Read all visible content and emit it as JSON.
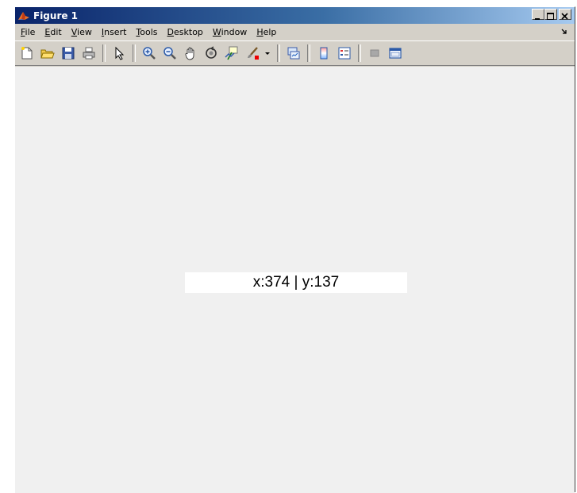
{
  "window": {
    "title": "Figure 1"
  },
  "menu": {
    "items": [
      {
        "key": "F",
        "rest": "ile"
      },
      {
        "key": "E",
        "rest": "dit"
      },
      {
        "key": "V",
        "rest": "iew"
      },
      {
        "key": "I",
        "rest": "nsert"
      },
      {
        "key": "T",
        "rest": "ools"
      },
      {
        "key": "D",
        "rest": "esktop"
      },
      {
        "key": "W",
        "rest": "indow"
      },
      {
        "key": "H",
        "rest": "elp"
      }
    ]
  },
  "toolbar": {
    "icons": [
      "new-figure-icon",
      "open-file-icon",
      "save-icon",
      "print-icon",
      "edit-plot-arrow-icon",
      "zoom-in-icon",
      "zoom-out-icon",
      "pan-hand-icon",
      "rotate-3d-icon",
      "data-cursor-icon",
      "brush-icon",
      "link-plot-icon",
      "insert-colorbar-icon",
      "insert-legend-icon",
      "hide-plot-tools-icon",
      "show-plot-tools-icon"
    ]
  },
  "readout": {
    "text": "x:374 | y:137"
  }
}
